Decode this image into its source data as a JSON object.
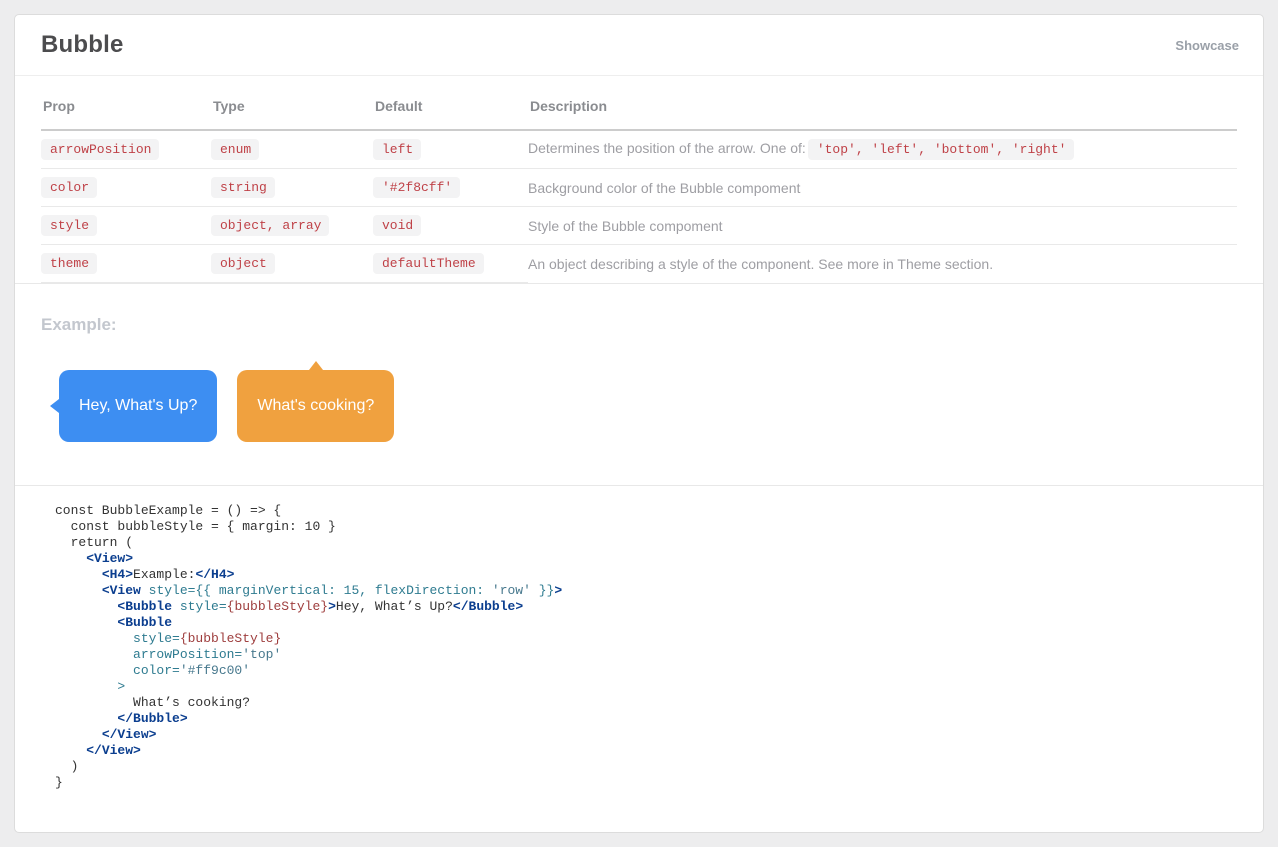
{
  "header": {
    "title": "Bubble",
    "link_label": "Showcase"
  },
  "props_table": {
    "columns": [
      "Prop",
      "Type",
      "Default",
      "Description"
    ],
    "rows": [
      {
        "prop": "arrowPosition",
        "type": "enum",
        "default": "left",
        "description": "Determines the position of the arrow. One of:",
        "description_code": "'top', 'left', 'bottom', 'right'"
      },
      {
        "prop": "color",
        "type": "string",
        "default": "'#2f8cff'",
        "description": "Background color of the Bubble compoment",
        "description_code": ""
      },
      {
        "prop": "style",
        "type": "object, array",
        "default": "void",
        "description": "Style of the Bubble compoment",
        "description_code": ""
      },
      {
        "prop": "theme",
        "type": "object",
        "default": "defaultTheme",
        "description": "An object describing a style of the component. See more in Theme section.",
        "description_code": ""
      }
    ]
  },
  "example": {
    "heading": "Example:",
    "bubbles": [
      {
        "text": "Hey, What's Up?",
        "color": "#3d8ef2",
        "arrow": "left"
      },
      {
        "text": "What's cooking?",
        "color": "#f0a13f",
        "arrow": "top"
      }
    ]
  },
  "code": {
    "lines": [
      [
        [
          "p",
          "const BubbleExample = () => {"
        ]
      ],
      [
        [
          "p",
          "  const bubbleStyle = { margin: 10 }"
        ]
      ],
      [
        [
          "p",
          "  return ("
        ]
      ],
      [
        [
          "p",
          "    "
        ],
        [
          "t",
          "<View>"
        ]
      ],
      [
        [
          "p",
          "      "
        ],
        [
          "t",
          "<H4>"
        ],
        [
          "p",
          "Example:"
        ],
        [
          "t",
          "</H4>"
        ]
      ],
      [
        [
          "p",
          "      "
        ],
        [
          "t",
          "<View"
        ],
        [
          "p",
          " "
        ],
        [
          "a",
          "style="
        ],
        [
          "a",
          "{{ marginVertical: 15, flexDirection: "
        ],
        [
          "s",
          "'row'"
        ],
        [
          "a",
          " }}"
        ],
        [
          "t",
          ">"
        ]
      ],
      [
        [
          "p",
          "        "
        ],
        [
          "t",
          "<Bubble"
        ],
        [
          "p",
          " "
        ],
        [
          "a",
          "style="
        ],
        [
          "e",
          "{bubbleStyle}"
        ],
        [
          "t",
          ">"
        ],
        [
          "p",
          "Hey, What’s Up?"
        ],
        [
          "t",
          "</Bubble>"
        ]
      ],
      [
        [
          "p",
          "        "
        ],
        [
          "t",
          "<Bubble"
        ]
      ],
      [
        [
          "p",
          "          "
        ],
        [
          "a",
          "style="
        ],
        [
          "e",
          "{bubbleStyle}"
        ]
      ],
      [
        [
          "p",
          "          "
        ],
        [
          "a",
          "arrowPosition="
        ],
        [
          "s",
          "'top'"
        ]
      ],
      [
        [
          "p",
          "          "
        ],
        [
          "a",
          "color="
        ],
        [
          "s",
          "'#ff9c00'"
        ]
      ],
      [
        [
          "p",
          "        "
        ],
        [
          "a",
          ">"
        ]
      ],
      [
        [
          "p",
          "          What’s cooking?"
        ]
      ],
      [
        [
          "p",
          "        "
        ],
        [
          "t",
          "</Bubble>"
        ]
      ],
      [
        [
          "p",
          "      "
        ],
        [
          "t",
          "</View>"
        ]
      ],
      [
        [
          "p",
          "    "
        ],
        [
          "t",
          "</View>"
        ]
      ],
      [
        [
          "p",
          "  )"
        ]
      ],
      [
        [
          "p",
          "}"
        ]
      ]
    ]
  },
  "colors": {
    "badge_text": "#bf4147",
    "tag_navy": "#0b3e8f",
    "attr_teal": "#2e7b90",
    "string_teal": "#47788d",
    "expr_red": "#9e3d3d"
  }
}
